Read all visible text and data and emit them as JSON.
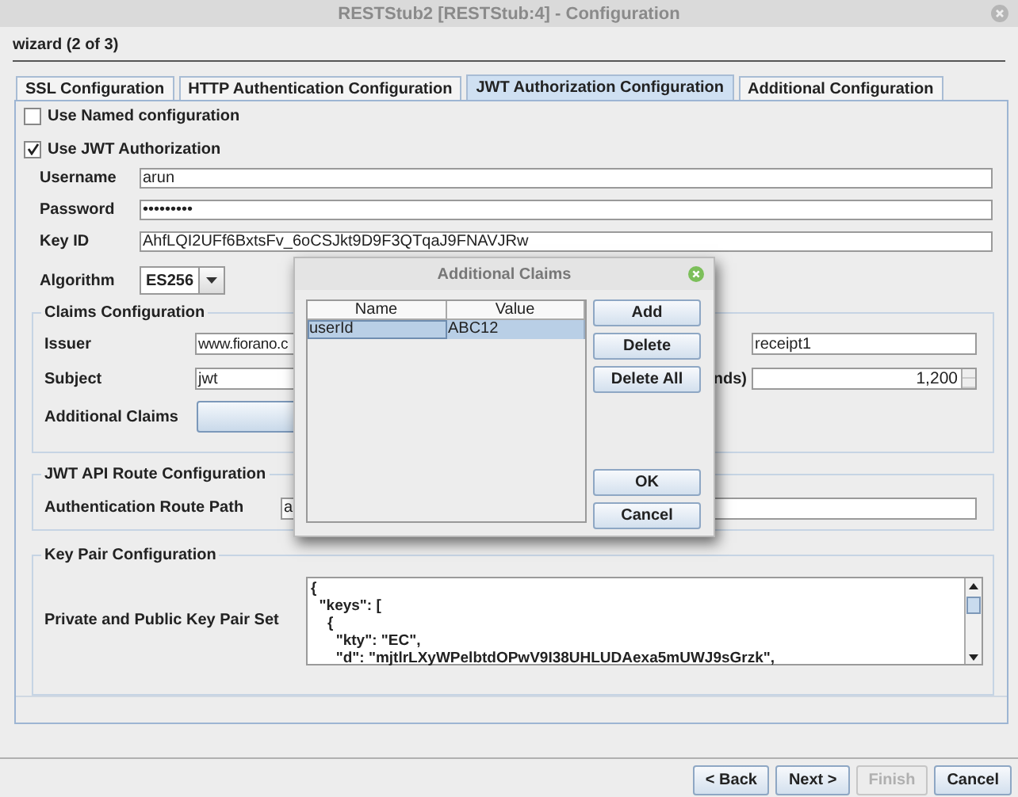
{
  "window": {
    "title": "RESTStub2 [RESTStub:4] - Configuration"
  },
  "wizard": {
    "step": "wizard (2 of 3)"
  },
  "tabs": [
    {
      "label": "SSL Configuration",
      "selected": false
    },
    {
      "label": "HTTP Authentication Configuration",
      "selected": false
    },
    {
      "label": "JWT Authorization Configuration",
      "selected": true
    },
    {
      "label": "Additional Configuration",
      "selected": false
    }
  ],
  "options": [
    {
      "label": "Use Named configuration",
      "checked": false
    },
    {
      "label": "Use JWT Authorization",
      "checked": true
    }
  ],
  "fields": [
    {
      "label": "Username",
      "value": "arun"
    },
    {
      "label": "Password",
      "value": "•••••••••"
    },
    {
      "label": "Key ID",
      "value": "AhfLQI2UFf6BxtsFv_6oCSJkt9D9F3QTqaJ9FNAVJRw"
    }
  ],
  "algorithm": {
    "label": "Algorithm",
    "value": "ES256"
  },
  "claims": {
    "title": "Claims Configuration",
    "issuer": {
      "label": "Issuer",
      "value": "www.fiorano.c"
    },
    "subject": {
      "label": "Subject",
      "value": "jwt"
    },
    "additional_claims": {
      "label": "Additional Claims"
    },
    "audience": {
      "value": "receipt1"
    },
    "expiry": {
      "label": "nds)",
      "value": "1,200"
    }
  },
  "route": {
    "title": "JWT API Route Configuration",
    "label": "Authentication Route Path",
    "value": "a"
  },
  "key_pair": {
    "title": "Key Pair Configuration",
    "label": "Private and Public Key Pair Set",
    "value": "{\n  \"keys\": [\n    {\n      \"kty\": \"EC\",\n      \"d\": \"mjtlrLXyWPelbtdOPwV9I38UHLUDAexa5mUWJ9sGrzk\","
  },
  "dialog": {
    "title": "Additional Claims",
    "columns": [
      "Name",
      "Value"
    ],
    "rows": [
      {
        "cells": [
          "userId",
          "ABC12"
        ],
        "selected": true
      }
    ],
    "buttons": [
      {
        "label": "Add",
        "kind": "action"
      },
      {
        "label": "Delete",
        "kind": "action"
      },
      {
        "label": "Delete All",
        "kind": "action"
      },
      {
        "label": "OK",
        "kind": "confirm"
      },
      {
        "label": "Cancel",
        "kind": "confirm"
      }
    ]
  },
  "footer": {
    "buttons": [
      {
        "label": "< Back",
        "disabled": false
      },
      {
        "label": "Next >",
        "disabled": false
      },
      {
        "label": "Finish",
        "disabled": true
      },
      {
        "label": "Cancel",
        "disabled": false
      }
    ]
  }
}
